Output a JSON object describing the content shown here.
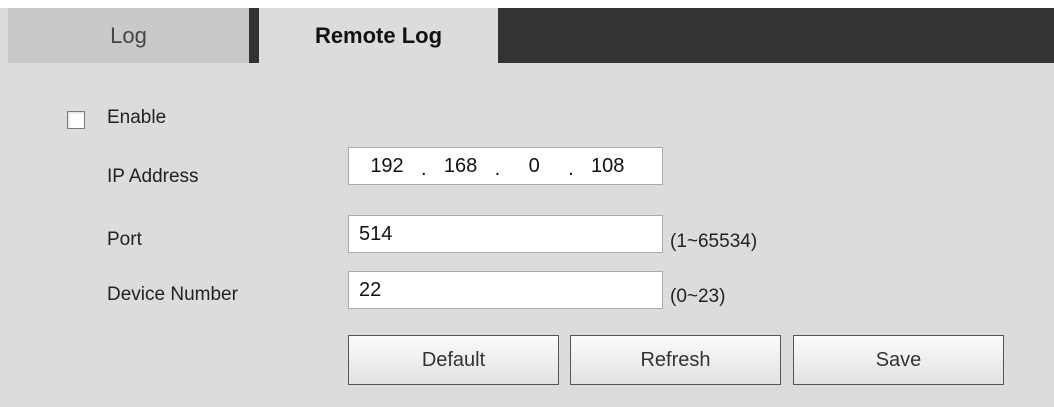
{
  "tabs": [
    {
      "label": "Log",
      "active": false
    },
    {
      "label": "Remote Log",
      "active": true
    }
  ],
  "form": {
    "enable": {
      "label": "Enable",
      "checked": false
    },
    "ip_address": {
      "label": "IP Address",
      "octets": [
        "192",
        "168",
        "0",
        "108"
      ]
    },
    "port": {
      "label": "Port",
      "value": "514",
      "range_hint": "(1~65534)"
    },
    "device_number": {
      "label": "Device Number",
      "value": "22",
      "range_hint": "(0~23)"
    }
  },
  "buttons": {
    "default": "Default",
    "refresh": "Refresh",
    "save": "Save"
  },
  "colors": {
    "background": "#dcdcdc",
    "tab_bar": "#333333",
    "inactive_tab": "#c9c9c9"
  }
}
